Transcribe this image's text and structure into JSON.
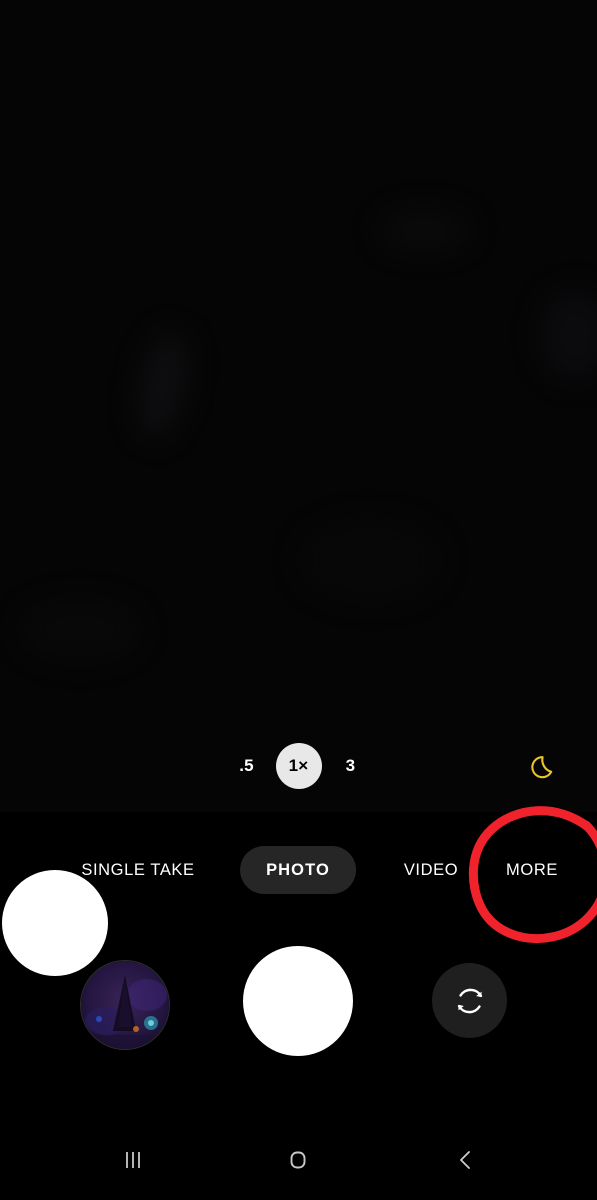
{
  "app": {
    "name": "Camera",
    "screen": "camera-viewfinder"
  },
  "viewfinder": {
    "state": "dark-scene",
    "background_color": "#050505"
  },
  "zoom_controls": {
    "options": [
      {
        "label": ".5",
        "value": "0.5",
        "selected": false
      },
      {
        "label": "1×",
        "value": "1",
        "selected": true
      },
      {
        "label": "3",
        "value": "3",
        "selected": false
      }
    ],
    "selected_label": "1×",
    "active_chip_bg": "#e8e8e8",
    "active_chip_fg": "#000000"
  },
  "night_mode": {
    "icon": "crescent-moon-icon",
    "color": "#e8c52a",
    "active": true
  },
  "modes": {
    "items": [
      {
        "label": "SINGLE TAKE",
        "selected": false
      },
      {
        "label": "PHOTO",
        "selected": true
      },
      {
        "label": "VIDEO",
        "selected": false
      },
      {
        "label": "MORE",
        "selected": false
      }
    ],
    "selected_label": "PHOTO",
    "selected_pill_color": "#262626"
  },
  "annotation": {
    "type": "hand-drawn-ellipse",
    "color": "#f0232c",
    "stroke_width": 9,
    "target_label": "MORE",
    "description": "Red hand-drawn circle around the MORE mode button"
  },
  "bottom_controls": {
    "gallery": {
      "icon": "gallery-thumbnail",
      "description": "circular photo thumbnail, dark purple night scene"
    },
    "shutter": {
      "icon": "shutter-button",
      "color": "#ffffff"
    },
    "switch_camera": {
      "icon": "camera-switch-icon",
      "button_color": "#1f1f1f"
    },
    "focus_highlight": {
      "icon": "white-circle-overlay",
      "color": "#ffffff"
    }
  },
  "navbar": {
    "buttons": [
      {
        "name": "recents",
        "icon": "recents-icon"
      },
      {
        "name": "home",
        "icon": "home-icon"
      },
      {
        "name": "back",
        "icon": "back-chevron-icon"
      }
    ],
    "icon_color": "#c9c9c9"
  }
}
